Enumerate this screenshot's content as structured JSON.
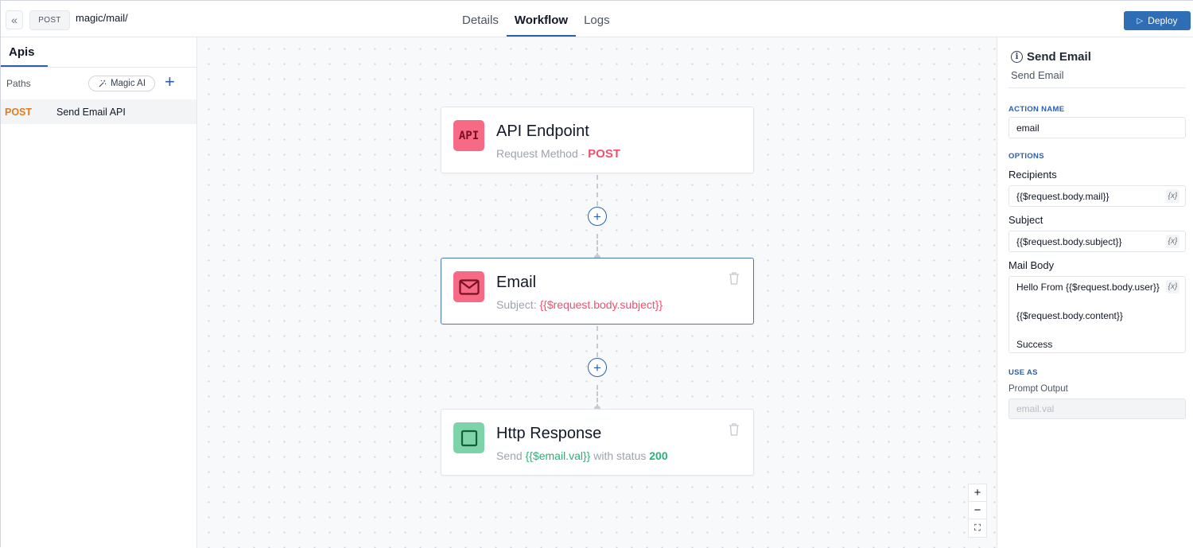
{
  "topbar": {
    "collapse_icon": "«",
    "method": "POST",
    "path": "magic/mail/",
    "tabs": [
      {
        "label": "Details",
        "active": false
      },
      {
        "label": "Workflow",
        "active": true
      },
      {
        "label": "Logs",
        "active": false
      }
    ],
    "deploy_label": "Deploy",
    "accent": "#2f6db5"
  },
  "sidebar": {
    "title": "Apis",
    "paths_label": "Paths",
    "magic_ai_label": "Magic AI",
    "add_icon": "+",
    "items": [
      {
        "method": "POST",
        "name": "Send Email API",
        "method_color": "#e07b24"
      }
    ]
  },
  "canvas": {
    "nodes": [
      {
        "title": "API Endpoint",
        "icon": "api-icon",
        "icon_text": "API",
        "sub_prefix": "Request Method - ",
        "sub_value": "POST"
      },
      {
        "title": "Email",
        "icon": "mail-icon",
        "sub_prefix": "Subject: ",
        "sub_value": "{{$request.body.subject}}"
      },
      {
        "title": "Http Response",
        "icon": "square-icon",
        "sub_prefix": "Send ",
        "sub_var": "{{$email.val}}",
        "sub_mid": " with status ",
        "sub_status": "200"
      }
    ],
    "add_node_icon": "+",
    "zoom": {
      "in": "+",
      "out": "−",
      "fit": "⛶"
    }
  },
  "panel": {
    "title": "Send Email",
    "subtitle": "Send Email",
    "action_name_label": "ACTION NAME",
    "action_name_value": "email",
    "options_label": "OPTIONS",
    "recipients_label": "Recipients",
    "recipients_value": "{{$request.body.mail}}",
    "subject_label": "Subject",
    "subject_value": "{{$request.body.subject}}",
    "mail_body_label": "Mail Body",
    "mail_body_lines": [
      "Hello From {{$request.body.user}}",
      "{{$request.body.content}}",
      "Success"
    ],
    "var_button": "{x}",
    "use_as_label": "USE AS",
    "prompt_output_label": "Prompt Output",
    "prompt_output_placeholder": "email.val"
  }
}
